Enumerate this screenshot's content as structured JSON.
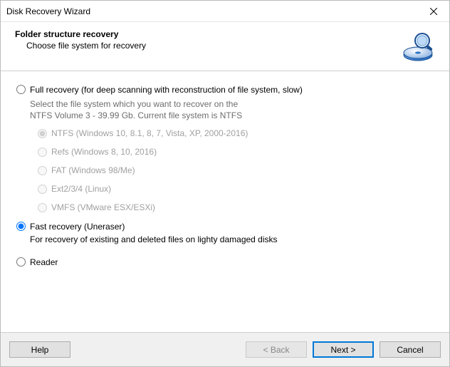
{
  "window": {
    "title": "Disk Recovery Wizard"
  },
  "header": {
    "title": "Folder structure recovery",
    "subtitle": "Choose file system for recovery"
  },
  "options": {
    "full": {
      "label": "Full recovery (for deep scanning with reconstruction of file system, slow)",
      "desc_line1": "Select the file system which you want to recover on the",
      "desc_line2": "NTFS Volume 3 - 39.99 Gb. Current file system is NTFS",
      "checked": false
    },
    "fast": {
      "label": "Fast recovery (Uneraser)",
      "desc": "For recovery of existing and deleted files on lighty damaged disks",
      "checked": true
    },
    "reader": {
      "label": "Reader",
      "checked": false
    }
  },
  "filesystems": {
    "ntfs": {
      "label": "NTFS (Windows 10, 8.1, 8, 7, Vista, XP, 2000-2016)",
      "checked": true
    },
    "refs": {
      "label": "Refs (Windows 8, 10, 2016)",
      "checked": false
    },
    "fat": {
      "label": "FAT (Windows 98/Me)",
      "checked": false
    },
    "ext": {
      "label": "Ext2/3/4 (Linux)",
      "checked": false
    },
    "vmfs": {
      "label": "VMFS (VMware ESX/ESXi)",
      "checked": false
    }
  },
  "footer": {
    "help": "Help",
    "back": "< Back",
    "next": "Next >",
    "cancel": "Cancel"
  }
}
